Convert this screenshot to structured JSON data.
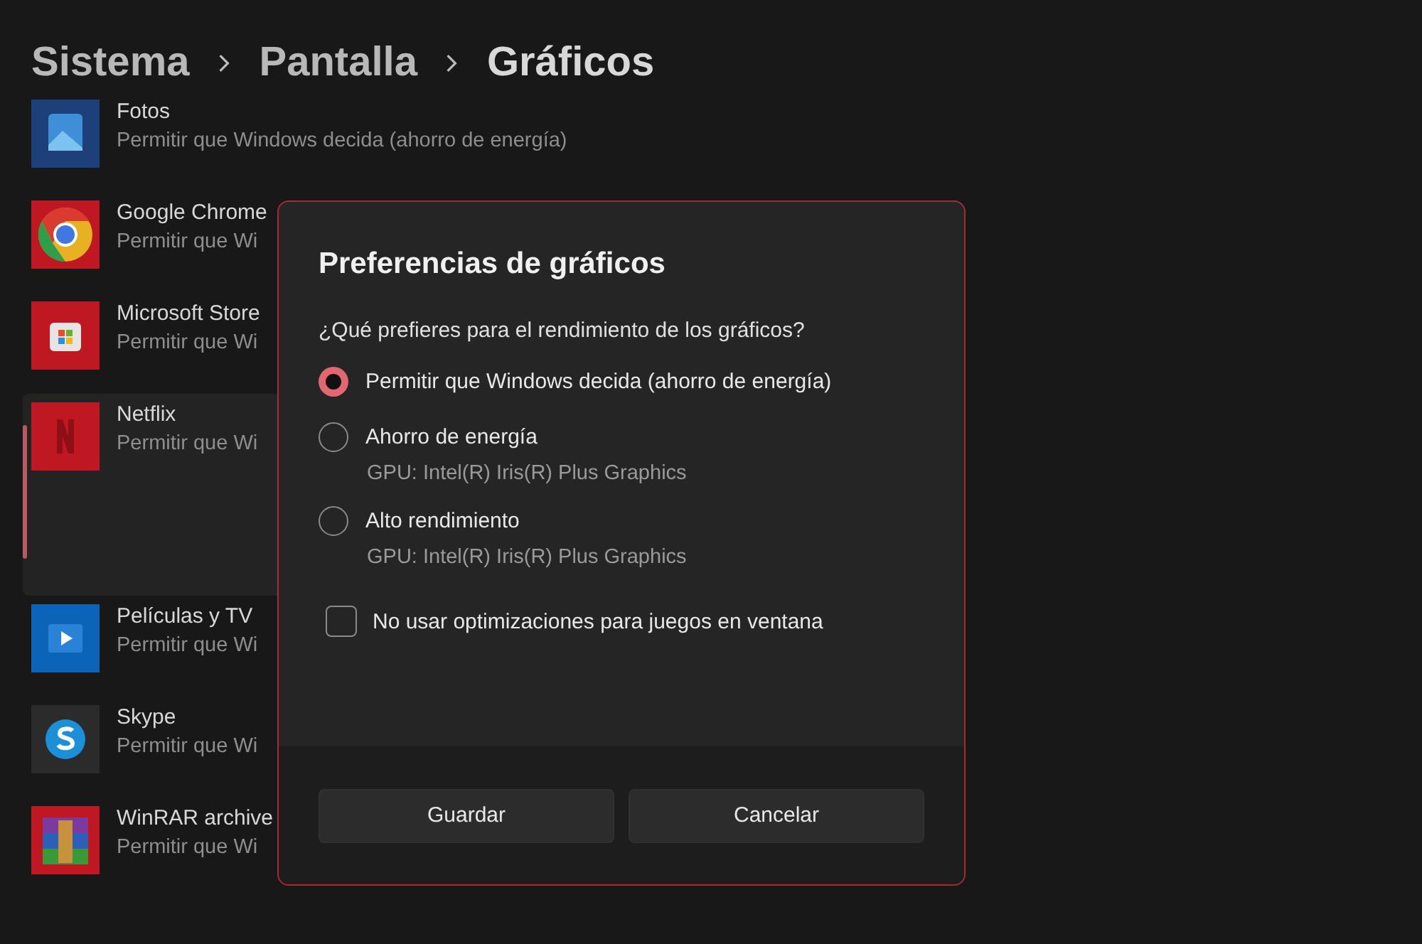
{
  "breadcrumb": [
    "Sistema",
    "Pantalla",
    "Gráficos"
  ],
  "apps": [
    {
      "name": "Fotos",
      "subtitle": "Permitir que Windows decida (ahorro de energía)",
      "kind": "photos",
      "selected": false
    },
    {
      "name": "Google Chrome",
      "subtitle": "Permitir que Wi",
      "kind": "chrome",
      "selected": false
    },
    {
      "name": "Microsoft Store",
      "subtitle": "Permitir que Wi",
      "kind": "store",
      "selected": false
    },
    {
      "name": "Netflix",
      "subtitle": "Permitir que Wi",
      "kind": "netflix",
      "selected": true
    },
    {
      "name": "Películas y TV",
      "subtitle": "Permitir que Wi",
      "kind": "movies",
      "selected": false
    },
    {
      "name": "Skype",
      "subtitle": "Permitir que Wi",
      "kind": "skype",
      "selected": false
    },
    {
      "name": "WinRAR archive",
      "subtitle": "Permitir que Wi",
      "kind": "winrar",
      "selected": false
    }
  ],
  "dialog": {
    "title": "Preferencias de gráficos",
    "question": "¿Qué prefieres para el rendimiento de los gráficos?",
    "options": [
      {
        "label": "Permitir que Windows decida (ahorro de energía)",
        "selected": true
      },
      {
        "label": "Ahorro de energía",
        "detail": "GPU: Intel(R) Iris(R) Plus Graphics",
        "selected": false
      },
      {
        "label": "Alto rendimiento",
        "detail": "GPU: Intel(R) Iris(R) Plus Graphics",
        "selected": false
      }
    ],
    "checkbox": {
      "label": "No usar optimizaciones para juegos en ventana",
      "checked": false
    },
    "buttons": [
      "Guardar",
      "Cancelar"
    ]
  }
}
